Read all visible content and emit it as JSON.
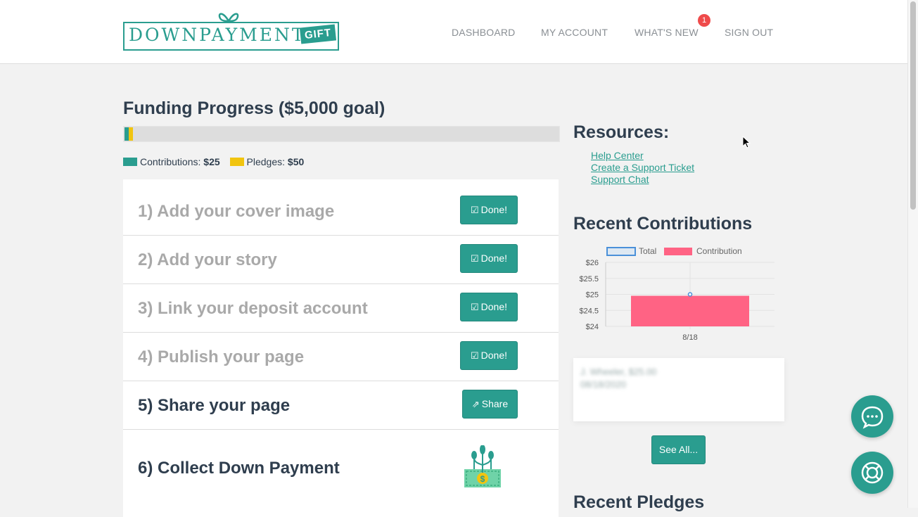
{
  "brand": {
    "name": "DOWNPAYMENT.",
    "suffix": "GIFT",
    "color": "#2a9d8f"
  },
  "nav": {
    "dashboard": "DASHBOARD",
    "my_account": "MY ACCOUNT",
    "whats_new": "WHAT'S NEW",
    "whats_new_badge": "1",
    "sign_out": "SIGN OUT"
  },
  "funding": {
    "title": "Funding Progress ($5,000 goal)",
    "goal": 5000,
    "contributions_label": "Contributions:",
    "contributions_value": "$25",
    "contributions_amount": 25,
    "pledges_label": "Pledges:",
    "pledges_value": "$50",
    "pledges_amount": 50,
    "contrib_color": "#2a9d8f",
    "pledge_color": "#f1c40f"
  },
  "steps": [
    {
      "label": "1) Add your cover image",
      "button": "Done!",
      "state": "done"
    },
    {
      "label": "2) Add your story",
      "button": "Done!",
      "state": "done"
    },
    {
      "label": "3) Link your deposit account",
      "button": "Done!",
      "state": "done"
    },
    {
      "label": "4) Publish your page",
      "button": "Done!",
      "state": "done"
    },
    {
      "label": "5) Share your page",
      "button": "Share",
      "state": "todo"
    },
    {
      "label": "6) Collect Down Payment",
      "state": "todo",
      "icon": "money-plant-icon"
    }
  ],
  "resources": {
    "title": "Resources:",
    "links": [
      "Help Center",
      "Create a Support Ticket",
      "Support Chat"
    ]
  },
  "recent_contributions": {
    "title": "Recent Contributions",
    "see_all": "See All...",
    "entries": [
      {
        "line1": "J. Wheeler, $25.00",
        "line2": "08/18/2020"
      }
    ]
  },
  "recent_pledges": {
    "title": "Recent Pledges"
  },
  "chart_data": {
    "type": "bar",
    "categories": [
      "8/18"
    ],
    "series": [
      {
        "name": "Total",
        "type": "line",
        "values": [
          25
        ],
        "color": "#4a90d9"
      },
      {
        "name": "Contribution",
        "type": "bar",
        "values": [
          25
        ],
        "color": "#ff6384"
      }
    ],
    "y_ticks": [
      "$26",
      "$25.5",
      "$25",
      "$24.5",
      "$24"
    ],
    "ylim": [
      24,
      26
    ],
    "legend": "top",
    "grid": true
  },
  "fabs": [
    "chat-bubble-icon",
    "lifebuoy-icon"
  ]
}
